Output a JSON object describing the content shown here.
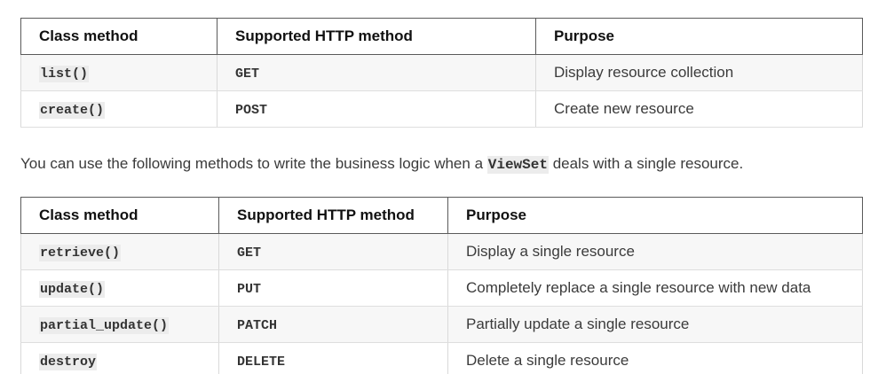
{
  "table1": {
    "headers": [
      "Class method",
      "Supported HTTP method",
      "Purpose"
    ],
    "rows": [
      [
        "list()",
        "GET",
        "Display resource collection"
      ],
      [
        "create()",
        "POST",
        "Create new resource"
      ]
    ]
  },
  "paragraph": {
    "before": "You can use the following methods to write the business logic when a ",
    "code": "ViewSet",
    "after": " deals with a single resource."
  },
  "table2": {
    "headers": [
      "Class method",
      "Supported HTTP method",
      "Purpose"
    ],
    "rows": [
      [
        "retrieve()",
        "GET",
        "Display a single resource"
      ],
      [
        "update()",
        "PUT",
        "Completely replace a single resource with new data"
      ],
      [
        "partial_update()",
        "PATCH",
        "Partially update a single resource"
      ],
      [
        "destroy",
        "DELETE",
        "Delete a single resource"
      ]
    ]
  }
}
